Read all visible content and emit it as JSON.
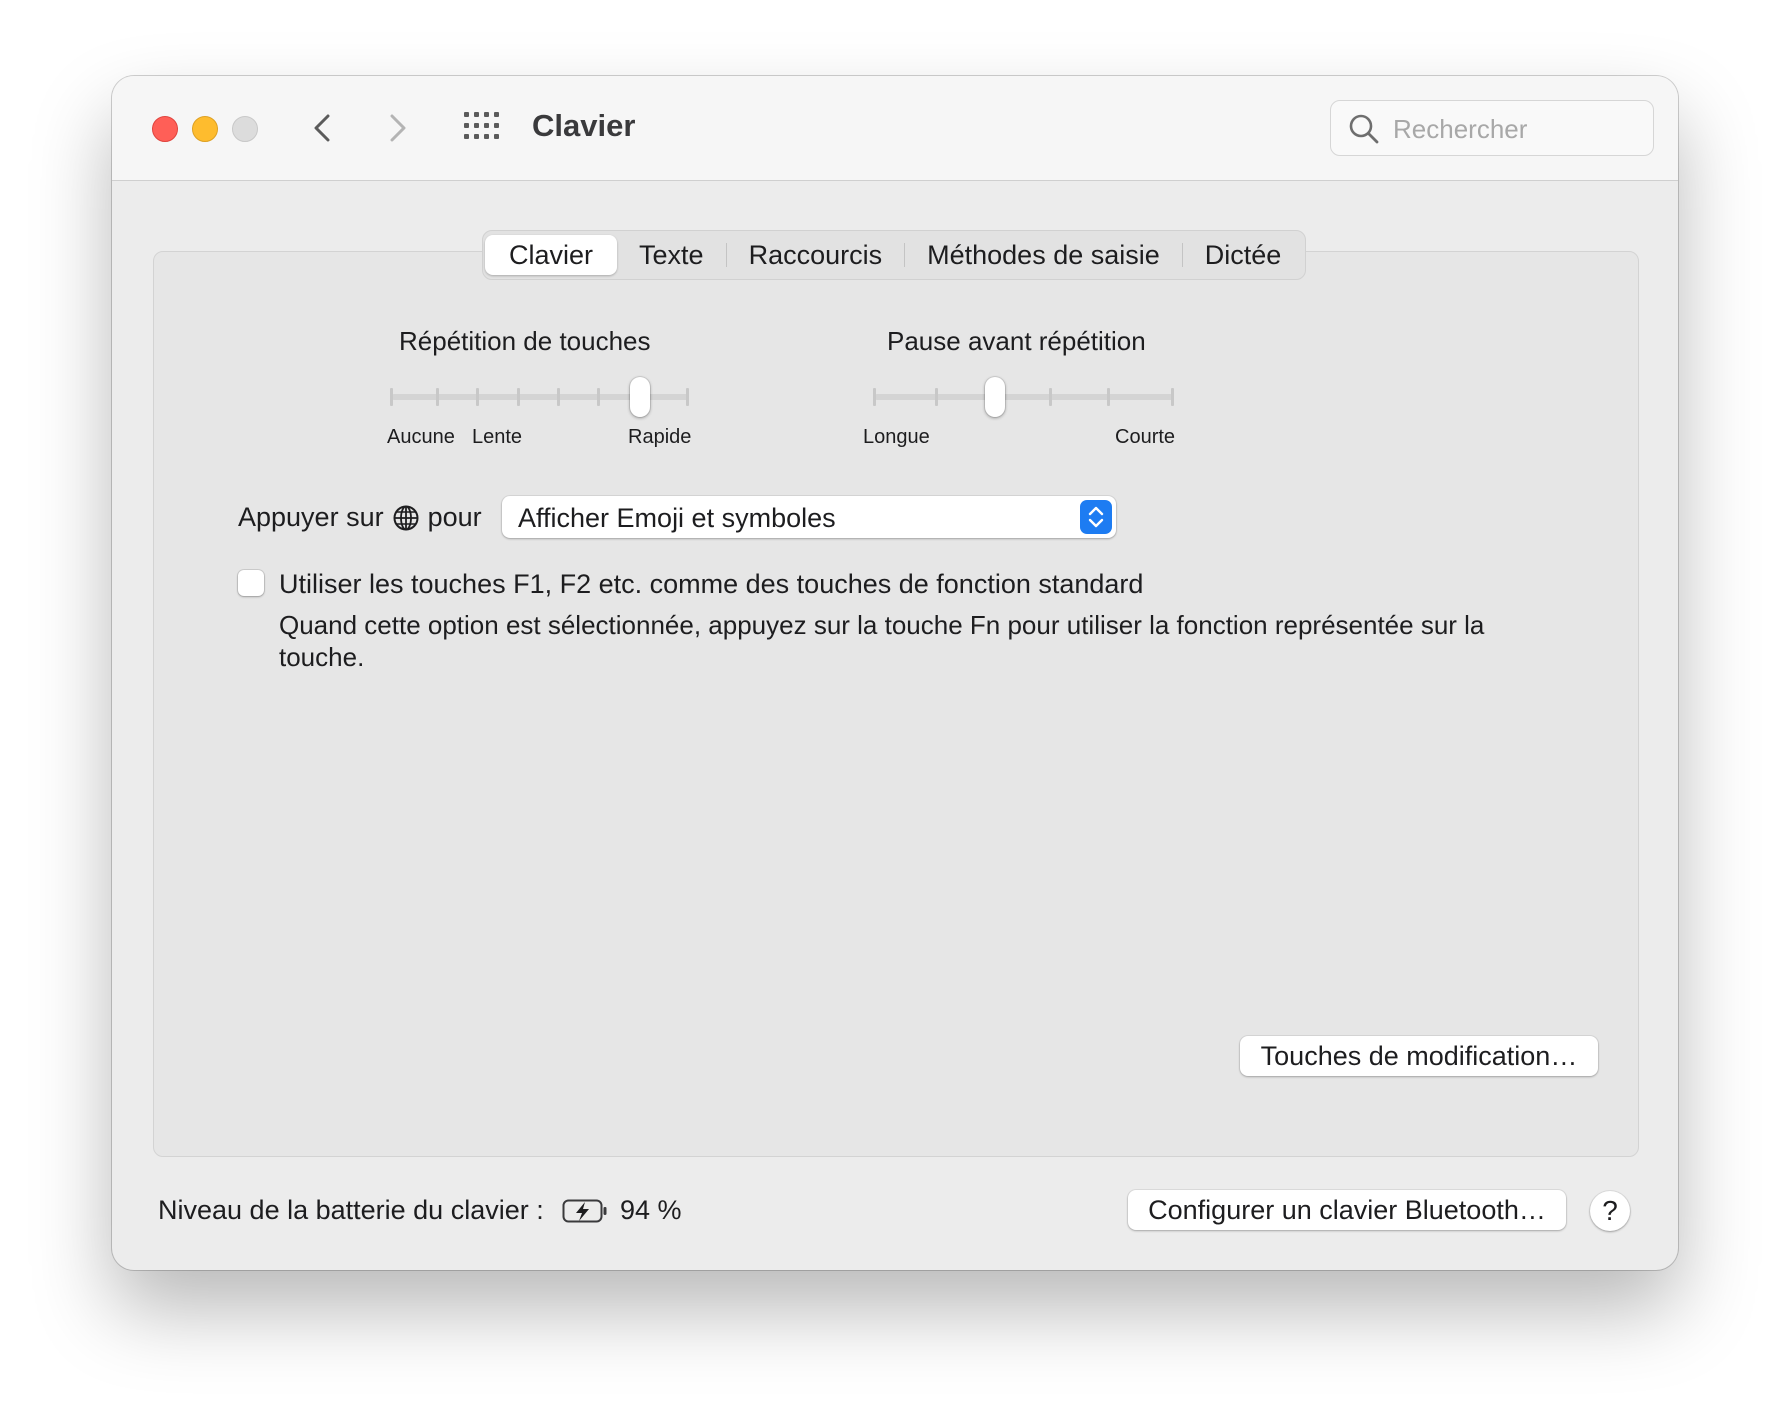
{
  "window": {
    "title": "Clavier",
    "search_placeholder": "Rechercher"
  },
  "tabs": [
    {
      "label": "Clavier",
      "active": true
    },
    {
      "label": "Texte",
      "active": false
    },
    {
      "label": "Raccourcis",
      "active": false
    },
    {
      "label": "Méthodes de saisie",
      "active": false
    },
    {
      "label": "Dictée",
      "active": false
    }
  ],
  "key_repeat": {
    "title": "Répétition de touches",
    "labels": [
      "Aucune",
      "Lente",
      "Rapide"
    ],
    "steps": 8,
    "selected_step": 6
  },
  "repeat_delay": {
    "title": "Pause avant répétition",
    "labels": [
      "Longue",
      "Courte"
    ],
    "steps": 6,
    "selected_step": 2
  },
  "globe_row": {
    "prefix": "Appuyer sur",
    "suffix": "pour",
    "icon": "globe-icon",
    "selected_value": "Afficher Emoji et symboles"
  },
  "fn_option": {
    "checked": false,
    "label": "Utiliser les touches F1, F2 etc. comme des touches de fonction standard",
    "help": "Quand cette option est sélectionnée, appuyez sur la touche Fn pour utiliser la fonction représentée sur la touche."
  },
  "buttons": {
    "modifier_keys": "Touches de modification…",
    "bluetooth_setup": "Configurer un clavier Bluetooth…",
    "help": "?"
  },
  "battery": {
    "label": "Niveau de la batterie du clavier :",
    "value": "94 %",
    "charging": true
  },
  "colors": {
    "close": "#ff5f57",
    "minimize": "#febc2e",
    "maximize": "#dcdcdc",
    "accent": "#1d7cf2",
    "window_bg": "#ececec",
    "panel_bg": "#e6e6e6"
  }
}
